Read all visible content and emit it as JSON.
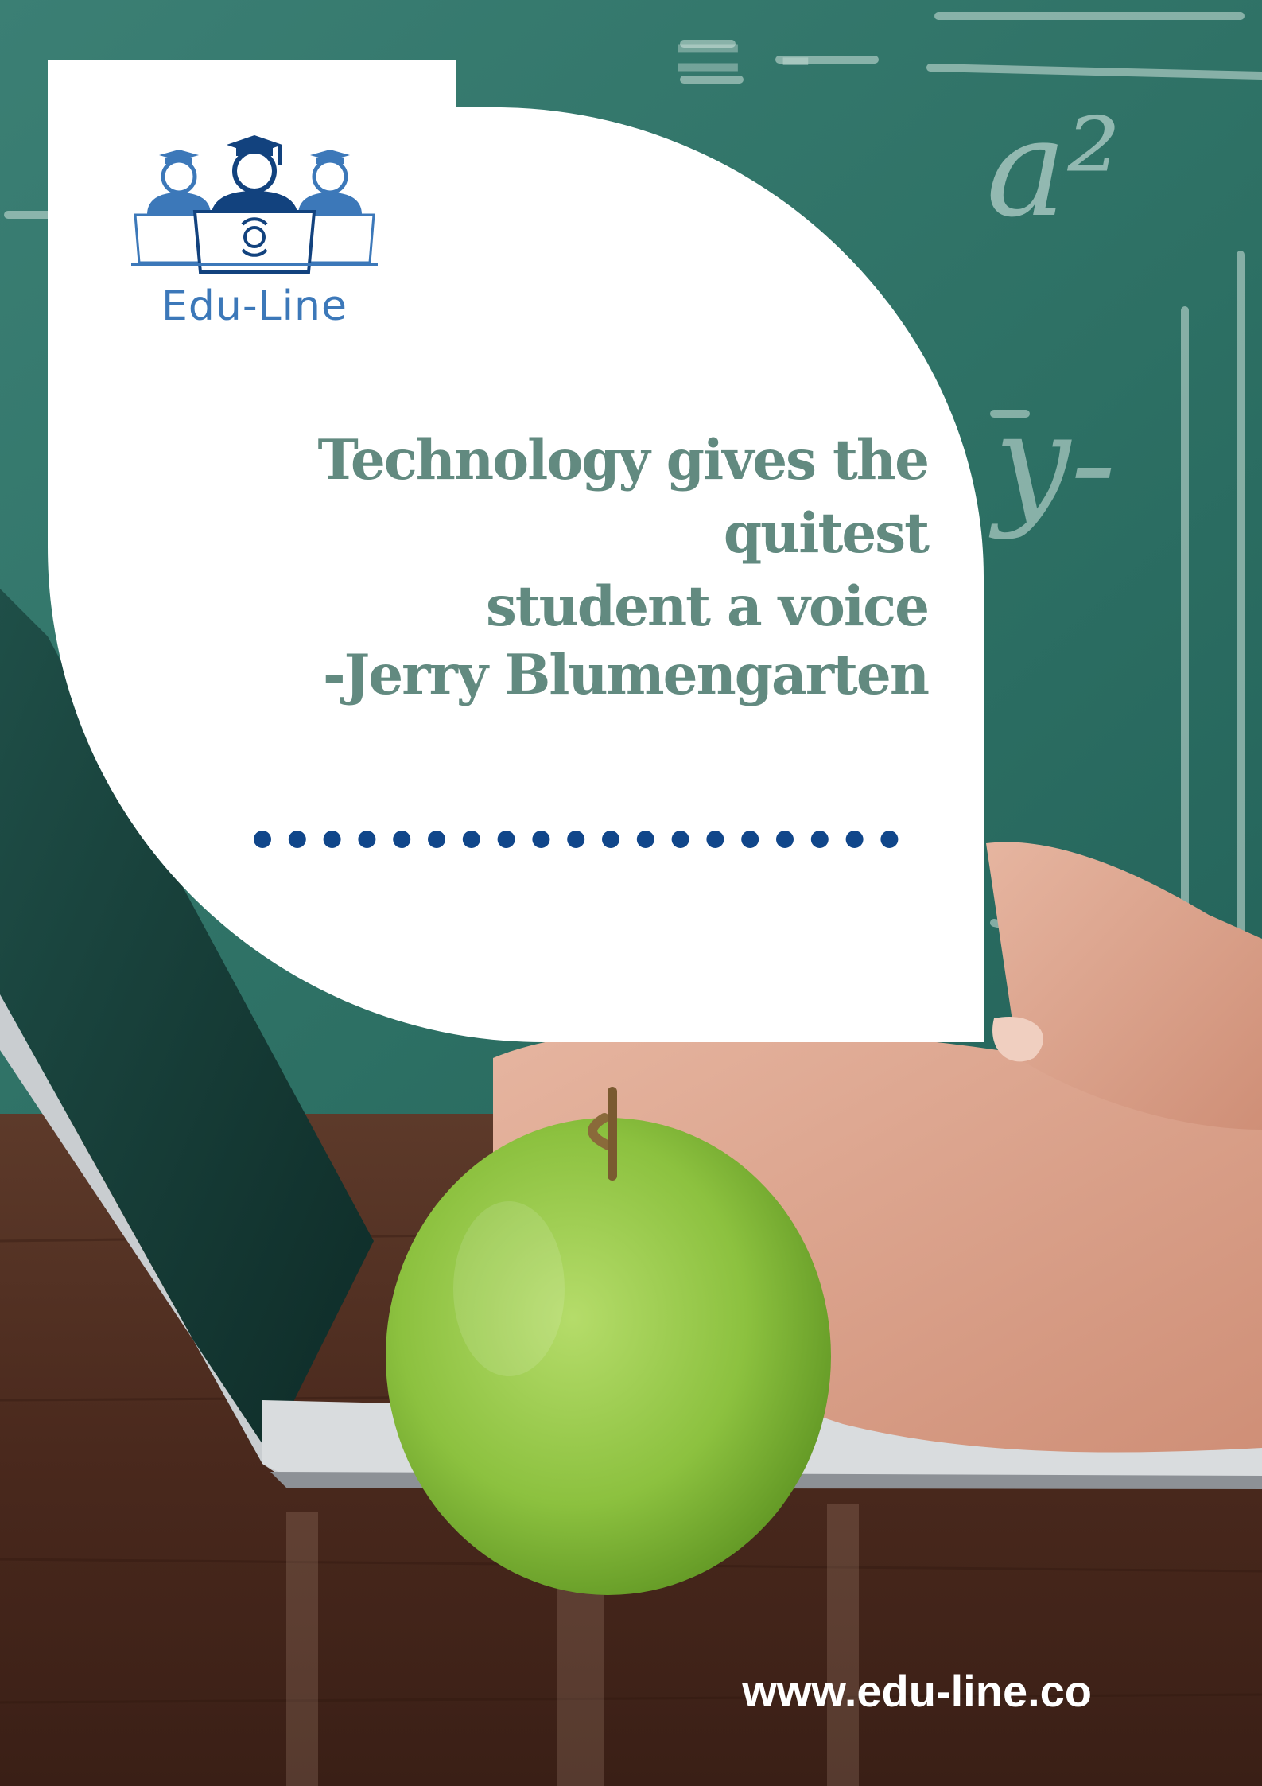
{
  "brand": {
    "name": "Edu-Line",
    "color": "#3c78b9",
    "dark_color": "#12427e"
  },
  "quote": {
    "lines": [
      "Technology gives the quitest",
      "student a voice"
    ],
    "author": "-Jerry Blumengarten",
    "text_color": "#628a80"
  },
  "separator": {
    "dot_count": 19,
    "dot_color": "#10468a"
  },
  "footer": {
    "website": "www.edu-line.co"
  },
  "chalkboard": [
    "a²",
    "y-",
    "= -"
  ],
  "colors": {
    "chalkboard": "#2f7468",
    "desk": "#4b2a1e",
    "apple": "#8cc13f"
  }
}
